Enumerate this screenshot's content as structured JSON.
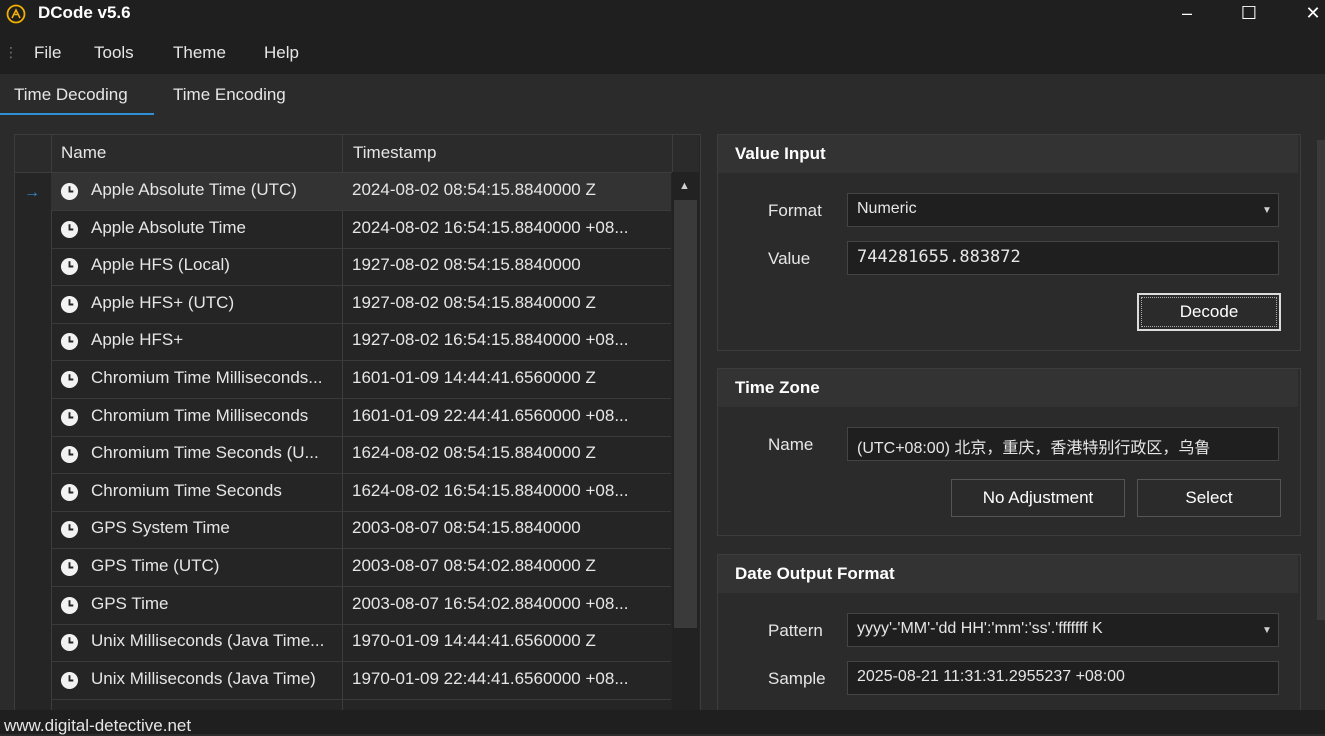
{
  "window": {
    "title": "DCode v5.6",
    "controls": {
      "minimize": "–",
      "maximize": "☐",
      "close": "✕"
    }
  },
  "menu": {
    "items": [
      "File",
      "Tools",
      "Theme",
      "Help"
    ]
  },
  "tabs": [
    {
      "label": "Time Decoding",
      "active": true
    },
    {
      "label": "Time Encoding",
      "active": false
    }
  ],
  "grid": {
    "columns": [
      "Name",
      "Timestamp"
    ],
    "rows": [
      {
        "name": "Apple Absolute Time (UTC)",
        "timestamp": "2024-08-02 08:54:15.8840000 Z"
      },
      {
        "name": "Apple Absolute Time",
        "timestamp": "2024-08-02 16:54:15.8840000 +08..."
      },
      {
        "name": "Apple HFS (Local)",
        "timestamp": "1927-08-02 08:54:15.8840000"
      },
      {
        "name": "Apple HFS+ (UTC)",
        "timestamp": "1927-08-02 08:54:15.8840000 Z"
      },
      {
        "name": "Apple HFS+",
        "timestamp": "1927-08-02 16:54:15.8840000 +08..."
      },
      {
        "name": "Chromium Time Milliseconds...",
        "timestamp": "1601-01-09 14:44:41.6560000 Z"
      },
      {
        "name": "Chromium Time Milliseconds",
        "timestamp": "1601-01-09 22:44:41.6560000 +08..."
      },
      {
        "name": "Chromium Time Seconds (U...",
        "timestamp": "1624-08-02 08:54:15.8840000 Z"
      },
      {
        "name": "Chromium Time Seconds",
        "timestamp": "1624-08-02 16:54:15.8840000 +08..."
      },
      {
        "name": "GPS System Time",
        "timestamp": "2003-08-07 08:54:15.8840000"
      },
      {
        "name": "GPS Time (UTC)",
        "timestamp": "2003-08-07 08:54:02.8840000 Z"
      },
      {
        "name": "GPS Time",
        "timestamp": "2003-08-07 16:54:02.8840000 +08..."
      },
      {
        "name": "Unix Milliseconds (Java Time...",
        "timestamp": "1970-01-09 14:44:41.6560000 Z"
      },
      {
        "name": "Unix Milliseconds (Java Time)",
        "timestamp": "1970-01-09 22:44:41.6560000 +08..."
      }
    ]
  },
  "value_input": {
    "title": "Value Input",
    "format_label": "Format",
    "format_value": "Numeric",
    "value_label": "Value",
    "value": "744281655.883872",
    "decode_button": "Decode"
  },
  "time_zone": {
    "title": "Time Zone",
    "name_label": "Name",
    "name_value": "(UTC+08:00) 北京，重庆，香港特别行政区，乌鲁",
    "no_adjustment_button": "No Adjustment",
    "select_button": "Select"
  },
  "date_output": {
    "title": "Date Output Format",
    "pattern_label": "Pattern",
    "pattern_value": "yyyy'-'MM'-'dd HH':'mm':'ss'.'fffffff K",
    "sample_label": "Sample",
    "sample_value": "2025-08-21 11:31:31.2955237 +08:00"
  },
  "status": {
    "text": "www.digital-detective.net"
  },
  "colors": {
    "accent": "#2f8fd7",
    "app_icon": "#f0b000",
    "background": "#2b2b2b"
  }
}
